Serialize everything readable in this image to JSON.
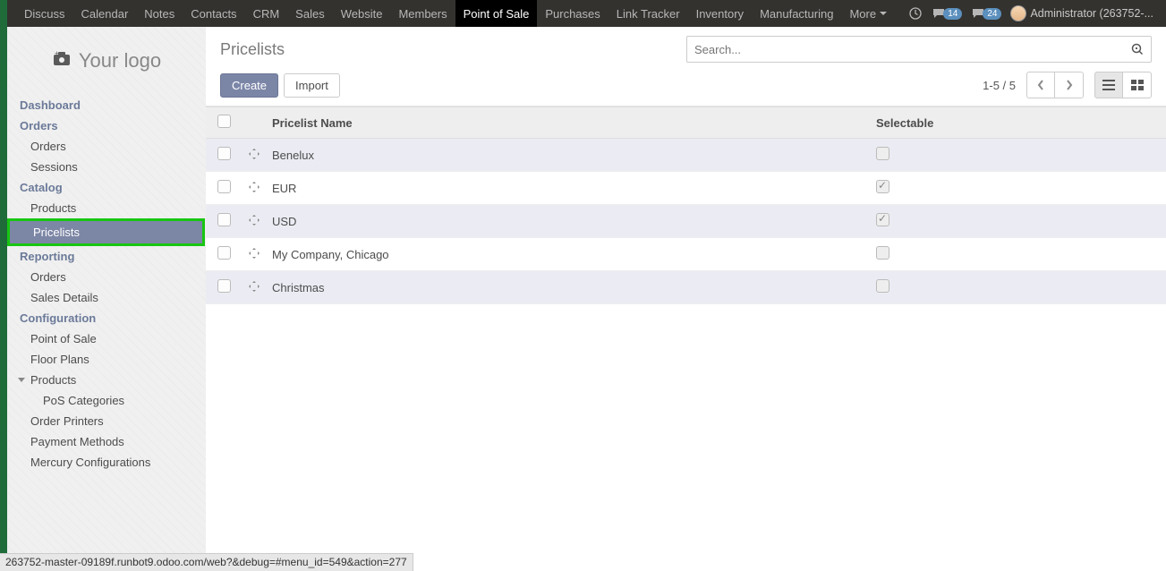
{
  "topnav": {
    "items": [
      "Discuss",
      "Calendar",
      "Notes",
      "Contacts",
      "CRM",
      "Sales",
      "Website",
      "Members",
      "Point of Sale",
      "Purchases",
      "Link Tracker",
      "Inventory",
      "Manufacturing"
    ],
    "active_index": 8,
    "more_label": "More",
    "badge1": "14",
    "badge2": "24",
    "user_label": "Administrator (263752-..."
  },
  "logo_text": "Your logo",
  "sidebar": {
    "sections": [
      {
        "title": "Dashboard",
        "items": []
      },
      {
        "title": "Orders",
        "items": [
          "Orders",
          "Sessions"
        ]
      },
      {
        "title": "Catalog",
        "items": [
          "Products",
          "Pricelists"
        ],
        "active_item_index": 1
      },
      {
        "title": "Reporting",
        "items": [
          "Orders",
          "Sales Details"
        ]
      },
      {
        "title": "Configuration",
        "items": [
          "Point of Sale",
          "Floor Plans",
          "Products",
          "PoS Categories",
          "Order Printers",
          "Payment Methods",
          "Mercury Configurations"
        ],
        "expandable_index": 2,
        "child_indices": [
          3
        ]
      }
    ]
  },
  "breadcrumb": "Pricelists",
  "search_placeholder": "Search...",
  "buttons": {
    "create": "Create",
    "import": "Import"
  },
  "pager": "1-5 / 5",
  "table": {
    "columns": [
      "Pricelist Name",
      "Selectable"
    ],
    "rows": [
      {
        "name": "Benelux",
        "selectable": false
      },
      {
        "name": "EUR",
        "selectable": true
      },
      {
        "name": "USD",
        "selectable": true
      },
      {
        "name": "My Company, Chicago",
        "selectable": false
      },
      {
        "name": "Christmas",
        "selectable": false
      }
    ]
  },
  "status_url": "263752-master-09189f.runbot9.odoo.com/web?&debug=#menu_id=549&action=277"
}
